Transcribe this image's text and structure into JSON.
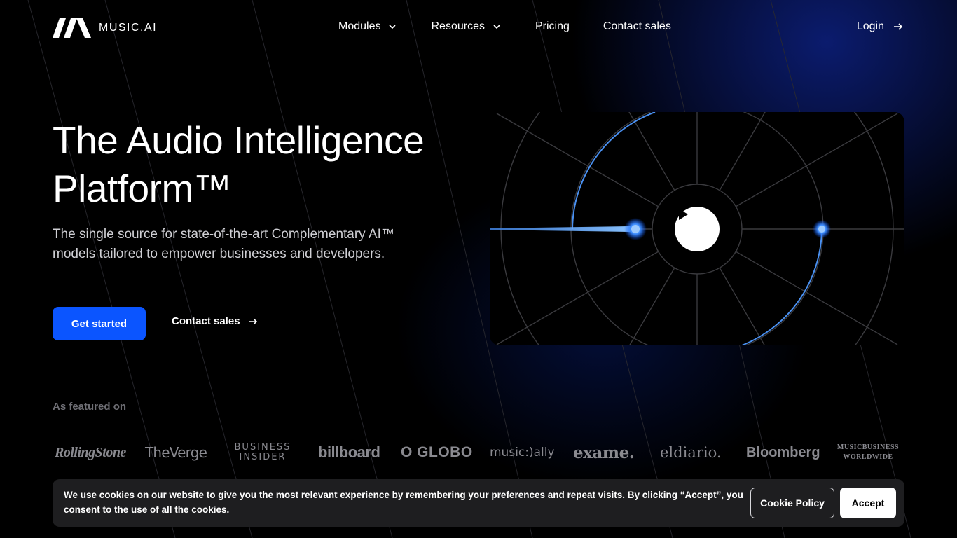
{
  "brand": {
    "name": "MUSIC.AI",
    "logo_icon": "music-ai-logo-icon"
  },
  "nav": {
    "items": [
      {
        "label": "Modules",
        "has_dropdown": true
      },
      {
        "label": "Resources",
        "has_dropdown": true
      },
      {
        "label": "Pricing",
        "has_dropdown": false
      },
      {
        "label": "Contact sales",
        "has_dropdown": false
      }
    ],
    "login": "Login"
  },
  "hero": {
    "title_line1": "The Audio Intelligence",
    "title_line2": "Platform™",
    "subtitle": "The single source for state-of-the-art Complementary AI™ models tailored to empower businesses and developers.",
    "cta_primary": "Get started",
    "cta_secondary": "Contact sales"
  },
  "video": {
    "play_icon": "play-icon"
  },
  "featured": {
    "label": "As featured on",
    "logos": [
      "RollingStone",
      "TheVerge",
      "BUSINESS INSIDER",
      "billboard",
      "O GLOBO",
      "music:)ally",
      "exame.",
      "eldiario.",
      "Bloomberg",
      "MUSICBUSINESS WORLDWIDE"
    ]
  },
  "cookie": {
    "text": "We use cookies on our website to give you the most relevant experience by remembering your preferences and repeat visits. By clicking “Accept”, you consent to the use of all the cookies.",
    "policy_button": "Cookie Policy",
    "accept_button": "Accept"
  },
  "colors": {
    "accent": "#0b55ff",
    "background": "#000000",
    "banner": "#1e1e20"
  }
}
